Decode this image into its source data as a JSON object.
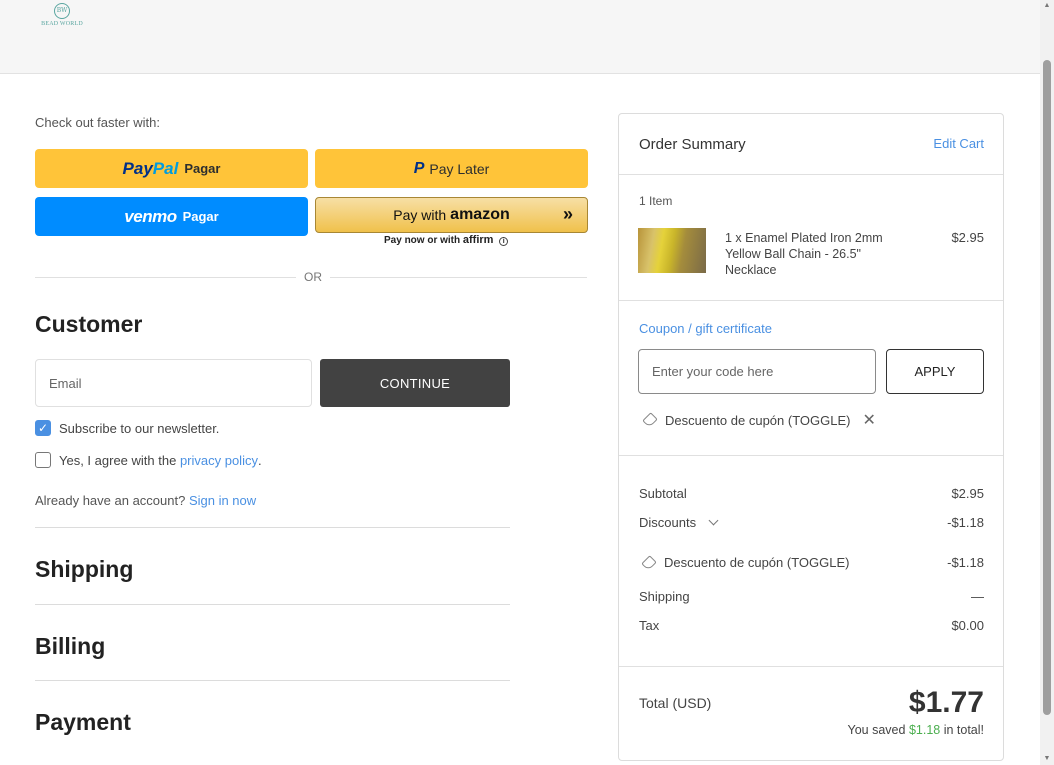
{
  "brand": {
    "logo_text": "BEAD WORLD",
    "logo_mark": "BW"
  },
  "express": {
    "heading": "Check out faster with:",
    "paypal": {
      "brand_a": "Pay",
      "brand_b": "Pal",
      "label": "Pagar"
    },
    "paylater": {
      "label": "Pay Later"
    },
    "venmo": {
      "brand": "venmo",
      "label": "Pagar"
    },
    "amazon": {
      "prefix": "Pay with",
      "brand": "amazon"
    },
    "affirm": {
      "prefix": "Pay now or with",
      "brand": "affirm"
    },
    "or_text": "OR"
  },
  "customer": {
    "title": "Customer",
    "email_placeholder": "Email",
    "continue_label": "CONTINUE",
    "newsletter_label": "Subscribe to our newsletter.",
    "newsletter_checked": true,
    "privacy_prefix": "Yes, I agree with the ",
    "privacy_link": "privacy policy",
    "privacy_suffix": ".",
    "privacy_checked": false,
    "account_prefix": "Already have an account? ",
    "signin_link": "Sign in now"
  },
  "sections": {
    "shipping": "Shipping",
    "billing": "Billing",
    "payment": "Payment"
  },
  "summary": {
    "title": "Order Summary",
    "edit_cart": "Edit Cart",
    "item_count": "1 Item",
    "item": {
      "name": "1 x Enamel Plated Iron 2mm Yellow Ball Chain - 26.5\" Necklace",
      "price": "$2.95"
    },
    "coupon_link": "Coupon / gift certificate",
    "coupon_placeholder": "Enter your code here",
    "apply_label": "APPLY",
    "applied_coupon": "Descuento de cupón (TOGGLE)",
    "subtotal_label": "Subtotal",
    "subtotal_value": "$2.95",
    "discounts_label": "Discounts",
    "discounts_value": "-$1.18",
    "coupon_line_label": "Descuento de cupón (TOGGLE)",
    "coupon_line_value": "-$1.18",
    "shipping_label": "Shipping",
    "shipping_value": "—",
    "tax_label": "Tax",
    "tax_value": "$0.00",
    "total_label": "Total (USD)",
    "total_value": "$1.77",
    "saved_prefix": "You saved ",
    "saved_amount": "$1.18",
    "saved_suffix": " in total!"
  }
}
